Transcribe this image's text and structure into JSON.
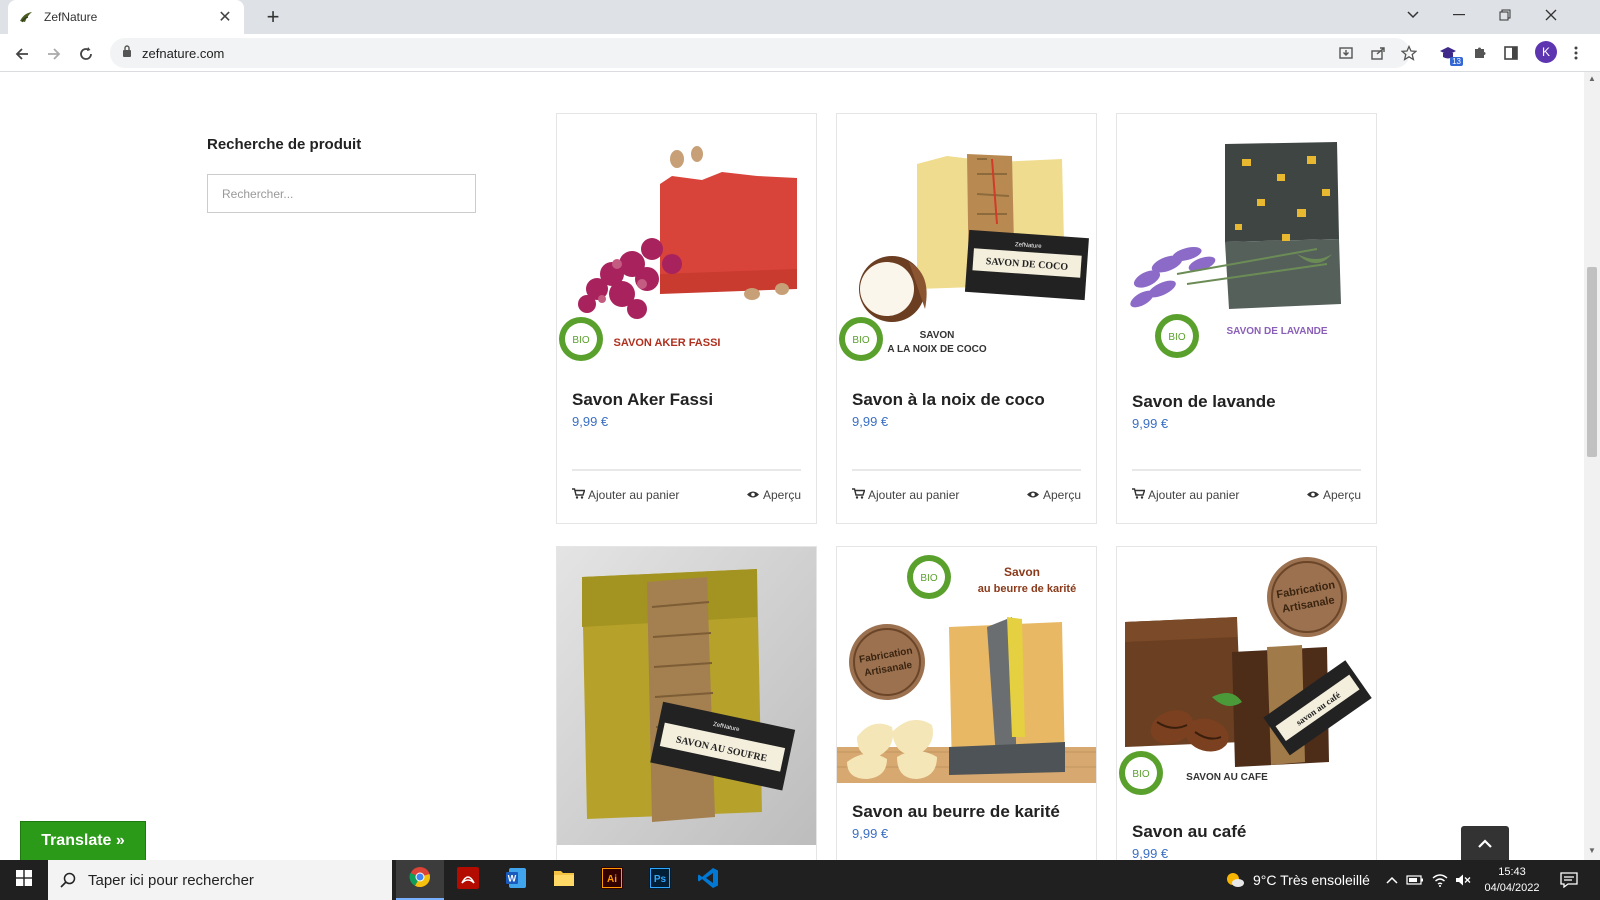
{
  "browser": {
    "tab_title": "ZefNature",
    "url": "zefnature.com",
    "extension_badge": "13",
    "profile_initial": "K"
  },
  "sidebar": {
    "title": "Recherche de produit",
    "search_placeholder": "Rechercher..."
  },
  "products": [
    {
      "name": "Savon Aker Fassi",
      "price": "9,99 €",
      "label": "SAVON AKER FASSI",
      "add_label": "Ajouter au panier",
      "preview_label": "Aperçu"
    },
    {
      "name": "Savon à la noix de coco",
      "price": "9,99 €",
      "label_line1": "SAVON",
      "label_line2": "A LA NOIX DE COCO",
      "tag": "SAVON DE COCO",
      "brand": "ZefNature",
      "add_label": "Ajouter au panier",
      "preview_label": "Aperçu"
    },
    {
      "name": "Savon de lavande",
      "price": "9,99 €",
      "label": "SAVON DE LAVANDE",
      "add_label": "Ajouter au panier",
      "preview_label": "Aperçu"
    },
    {
      "name": "",
      "price": "",
      "tag": "SAVON AU SOUFRE",
      "brand": "ZefNature"
    },
    {
      "name": "Savon au beurre de karité",
      "price": "9,99 €",
      "label_line1": "Savon",
      "label_line2": "au beurre de karité",
      "stamp_line1": "Fabrication",
      "stamp_line2": "Artisanale"
    },
    {
      "name": "Savon au café",
      "price": "9,99 €",
      "label": "SAVON AU CAFE",
      "tag": "savon au café",
      "stamp_line1": "Fabrication",
      "stamp_line2": "Artisanale"
    }
  ],
  "bio_badge": "BIO",
  "translate_label": "Translate »",
  "taskbar": {
    "search_placeholder": "Taper ici pour rechercher",
    "weather": "9°C  Très ensoleillé",
    "time": "15:43",
    "date": "04/04/2022"
  },
  "colors": {
    "price": "#3a6fc4",
    "translate": "#2b9a18",
    "bio_green": "#5aa02c"
  }
}
